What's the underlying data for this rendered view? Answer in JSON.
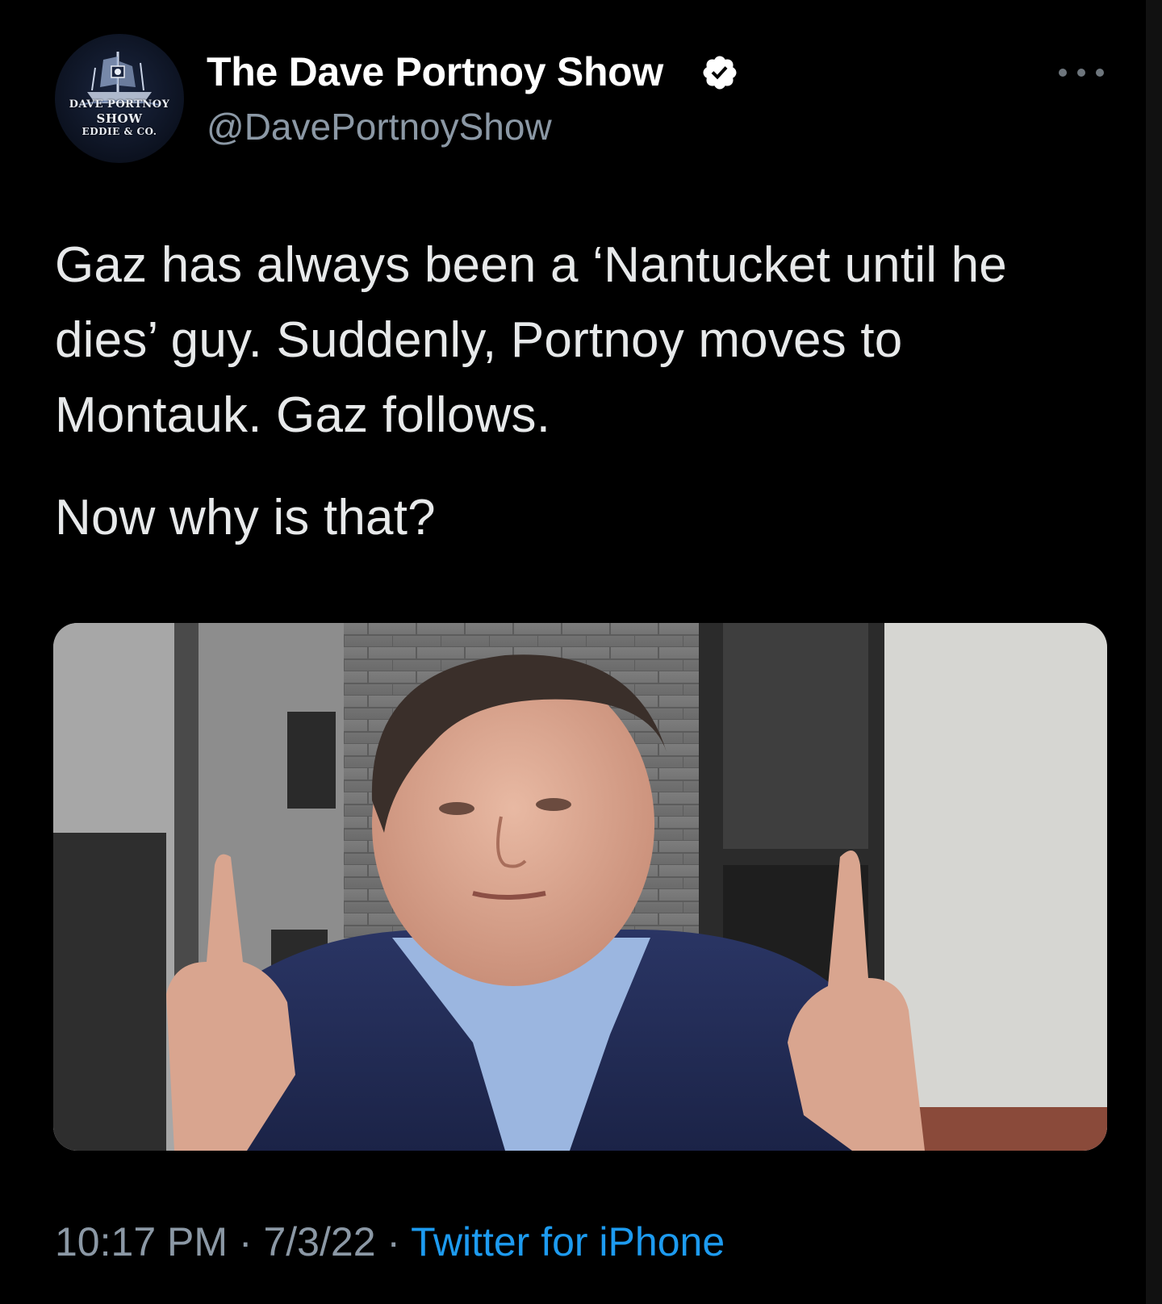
{
  "tweet": {
    "display_name": "The Dave Portnoy Show",
    "handle": "@DavePortnoyShow",
    "avatar": {
      "line1": "DAVE PORTNOY",
      "line2": "SHOW",
      "line3": "EDDIE & CO."
    },
    "text_paragraphs": [
      "Gaz has always been a ‘Nantucket until he dies’ guy. Suddenly, Portnoy moves to Montauk. Gaz follows.",
      "Now why is that?"
    ],
    "time": "10:17 PM",
    "separator": "·",
    "date": "7/3/22",
    "source": "Twitter for iPhone"
  },
  "colors": {
    "background": "#000000",
    "text": "#e7e9ea",
    "muted": "#8b98a5",
    "link": "#1d9bf0",
    "verified": "#ffffff"
  },
  "icons": {
    "verified": "verified-badge-icon",
    "more": "more-horizontal-icon"
  }
}
